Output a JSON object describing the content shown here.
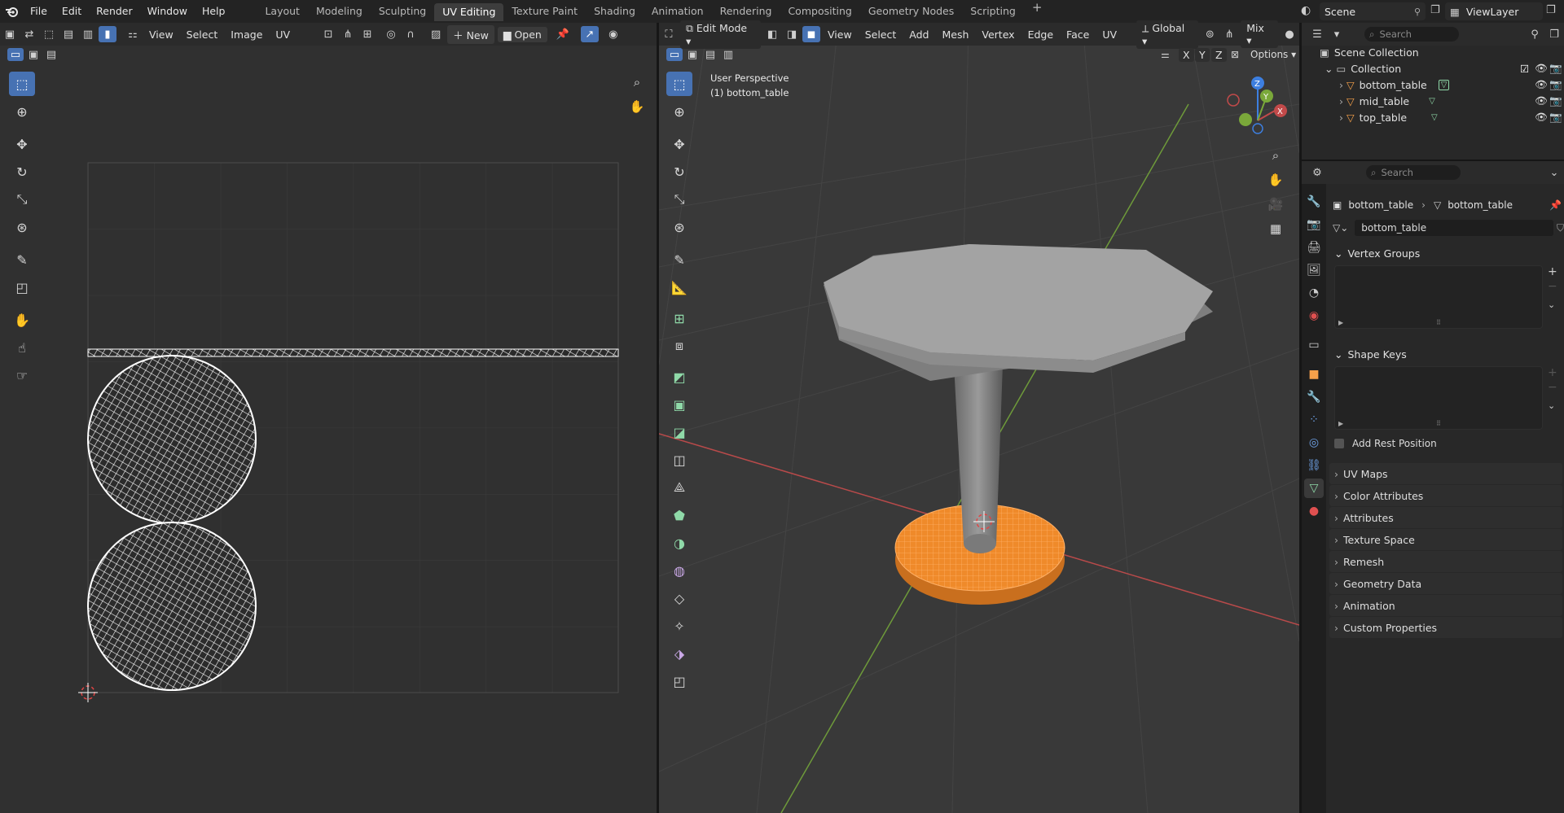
{
  "topbar": {
    "menus": [
      "File",
      "Edit",
      "Render",
      "Window",
      "Help"
    ],
    "workspaces": [
      "Layout",
      "Modeling",
      "Sculpting",
      "UV Editing",
      "Texture Paint",
      "Shading",
      "Animation",
      "Rendering",
      "Compositing",
      "Geometry Nodes",
      "Scripting"
    ],
    "active_workspace": "UV Editing",
    "add_tab": "+",
    "scene": "Scene",
    "view_layer": "ViewLayer"
  },
  "uv_editor": {
    "menus": [
      "View",
      "Select",
      "Image",
      "UV"
    ],
    "new_label": "New",
    "open_label": "Open"
  },
  "viewport": {
    "mode": "Edit Mode",
    "menus": [
      "View",
      "Select",
      "Add",
      "Mesh",
      "Vertex",
      "Edge",
      "Face",
      "UV"
    ],
    "orientation": "Global",
    "proportional": "Mix",
    "axes": [
      "X",
      "Y",
      "Z"
    ],
    "options_label": "Options",
    "overlay_line1": "User Perspective",
    "overlay_line2": "(1) bottom_table"
  },
  "outliner": {
    "search_placeholder": "Search",
    "scene_collection": "Scene Collection",
    "collection": "Collection",
    "objects": [
      "bottom_table",
      "mid_table",
      "top_table"
    ]
  },
  "properties": {
    "search_placeholder": "Search",
    "breadcrumb_object": "bottom_table",
    "breadcrumb_mesh": "bottom_table",
    "mesh_name": "bottom_table",
    "vertex_groups": "Vertex Groups",
    "shape_keys": "Shape Keys",
    "add_rest_position": "Add Rest Position",
    "sections": [
      "UV Maps",
      "Color Attributes",
      "Attributes",
      "Texture Space",
      "Remesh",
      "Geometry Data",
      "Animation",
      "Custom Properties"
    ]
  },
  "colors": {
    "accent": "#4772b3",
    "selection": "#f58f28",
    "x_axis": "#c24a4a",
    "y_axis": "#7aa83a",
    "z_axis": "#3d7fe0"
  }
}
